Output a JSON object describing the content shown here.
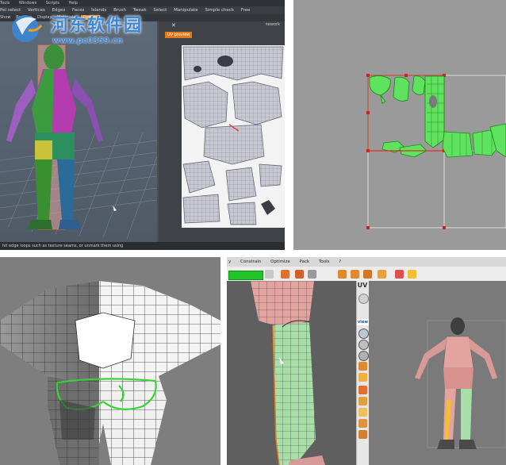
{
  "watermark": {
    "site_name": "河东软件园",
    "url": "www.pc0359.cn"
  },
  "panel1": {
    "menu": [
      "Tools",
      "Windows",
      "Scripts",
      "Help"
    ],
    "toolbar": [
      "Pel select",
      "Vertices",
      "Edges",
      "Faces",
      "Islands",
      "Brush",
      "Tweak",
      "Select",
      "Manipulate",
      "Simple check",
      "Free"
    ],
    "toolbar2": [
      "Show",
      "Remove",
      "Display",
      "Materials",
      "Objects"
    ],
    "active_tab": "Objects",
    "uv_preview_title": "UV preview",
    "network_label": "nework",
    "status_text": "hit edge loops such as texture seams, or unmark them using",
    "command_prompt": "(1):"
  },
  "panel4": {
    "menu": [
      "y",
      "Constrain",
      "Optimize",
      "Pack",
      "Tools",
      "?"
    ],
    "uv_label": "UV",
    "view_label": "view"
  },
  "colors": {
    "accent_orange": "#e37b1d",
    "uv_green": "#23c42a",
    "watermark_blue": "#3c86d6"
  }
}
